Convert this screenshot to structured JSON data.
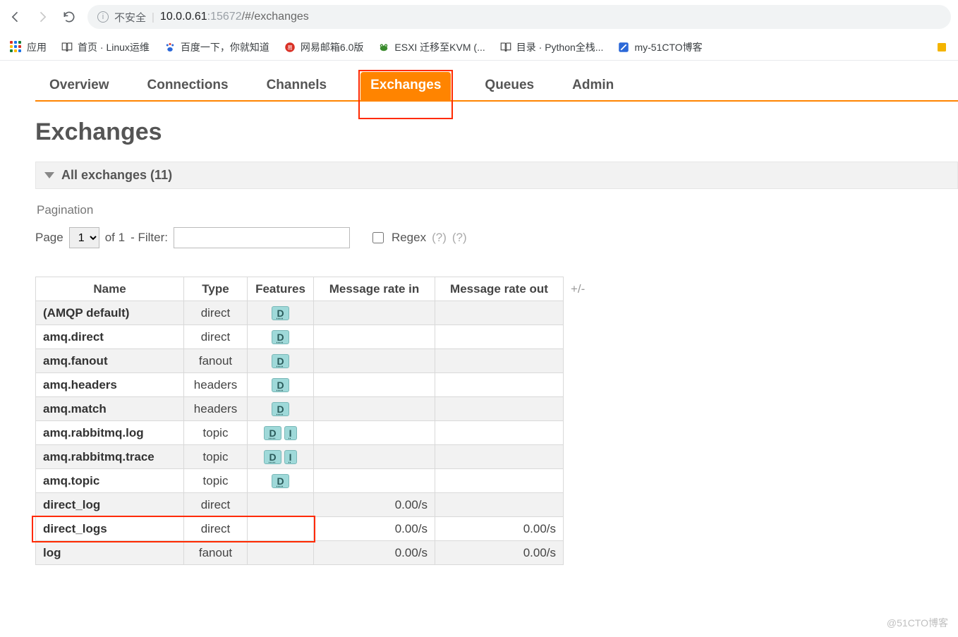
{
  "browser": {
    "insecure_label": "不安全",
    "url_host": "10.0.0.61",
    "url_port": ":15672",
    "url_path": "/#/exchanges",
    "apps_label": "应用",
    "bookmarks": [
      {
        "label": "首页 · Linux运维"
      },
      {
        "label": "百度一下，你就知道"
      },
      {
        "label": "网易邮箱6.0版"
      },
      {
        "label": "ESXI 迁移至KVM (..."
      },
      {
        "label": "目录 · Python全栈..."
      },
      {
        "label": "my-51CTO博客"
      }
    ]
  },
  "tabs": {
    "overview": "Overview",
    "connections": "Connections",
    "channels": "Channels",
    "exchanges": "Exchanges",
    "queues": "Queues",
    "admin": "Admin"
  },
  "page": {
    "title": "Exchanges",
    "section_header": "All exchanges (11)",
    "pagination_label": "Pagination",
    "page_label": "Page",
    "page_value": "1",
    "of_label": "of 1",
    "filter_label": "- Filter:",
    "regex_label": "Regex",
    "regex_help1": "(?)",
    "regex_help2": "(?)",
    "plusminus": "+/-"
  },
  "table": {
    "headers": {
      "name": "Name",
      "type": "Type",
      "features": "Features",
      "rate_in": "Message rate in",
      "rate_out": "Message rate out"
    },
    "rows": [
      {
        "name": "(AMQP default)",
        "type": "direct",
        "features": [
          "D"
        ],
        "rate_in": "",
        "rate_out": "",
        "alt": true
      },
      {
        "name": "amq.direct",
        "type": "direct",
        "features": [
          "D"
        ],
        "rate_in": "",
        "rate_out": "",
        "alt": false
      },
      {
        "name": "amq.fanout",
        "type": "fanout",
        "features": [
          "D"
        ],
        "rate_in": "",
        "rate_out": "",
        "alt": true
      },
      {
        "name": "amq.headers",
        "type": "headers",
        "features": [
          "D"
        ],
        "rate_in": "",
        "rate_out": "",
        "alt": false
      },
      {
        "name": "amq.match",
        "type": "headers",
        "features": [
          "D"
        ],
        "rate_in": "",
        "rate_out": "",
        "alt": true
      },
      {
        "name": "amq.rabbitmq.log",
        "type": "topic",
        "features": [
          "D",
          "I"
        ],
        "rate_in": "",
        "rate_out": "",
        "alt": false
      },
      {
        "name": "amq.rabbitmq.trace",
        "type": "topic",
        "features": [
          "D",
          "I"
        ],
        "rate_in": "",
        "rate_out": "",
        "alt": true
      },
      {
        "name": "amq.topic",
        "type": "topic",
        "features": [
          "D"
        ],
        "rate_in": "",
        "rate_out": "",
        "alt": false
      },
      {
        "name": "direct_log",
        "type": "direct",
        "features": [],
        "rate_in": "0.00/s",
        "rate_out": "",
        "alt": true
      },
      {
        "name": "direct_logs",
        "type": "direct",
        "features": [],
        "rate_in": "0.00/s",
        "rate_out": "0.00/s",
        "alt": false
      },
      {
        "name": "log",
        "type": "fanout",
        "features": [],
        "rate_in": "0.00/s",
        "rate_out": "0.00/s",
        "alt": true
      }
    ]
  },
  "watermark": "@51CTO博客"
}
